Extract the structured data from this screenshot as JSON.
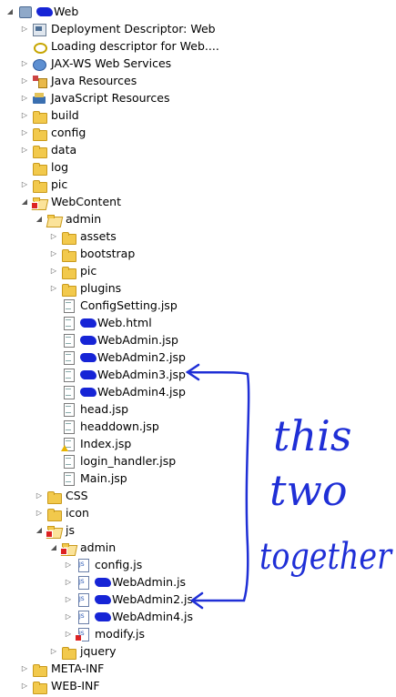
{
  "tree": [
    {
      "label": "Web",
      "level": 0,
      "twisty": "open",
      "icon": "project",
      "scribble": true
    },
    {
      "label": "Deployment Descriptor: Web",
      "level": 1,
      "twisty": "closed",
      "icon": "descriptor"
    },
    {
      "label": "Loading descriptor for Web....",
      "level": 1,
      "twisty": "none",
      "icon": "loading"
    },
    {
      "label": "JAX-WS Web Services",
      "level": 1,
      "twisty": "closed",
      "icon": "jaxws"
    },
    {
      "label": "Java Resources",
      "level": 1,
      "twisty": "closed",
      "icon": "java-resources"
    },
    {
      "label": "JavaScript Resources",
      "level": 1,
      "twisty": "closed",
      "icon": "js-resources"
    },
    {
      "label": "build",
      "level": 1,
      "twisty": "closed",
      "icon": "folder"
    },
    {
      "label": "config",
      "level": 1,
      "twisty": "closed",
      "icon": "folder"
    },
    {
      "label": "data",
      "level": 1,
      "twisty": "closed",
      "icon": "folder"
    },
    {
      "label": "log",
      "level": 1,
      "twisty": "none",
      "icon": "folder"
    },
    {
      "label": "pic",
      "level": 1,
      "twisty": "closed",
      "icon": "folder"
    },
    {
      "label": "WebContent",
      "level": 1,
      "twisty": "open",
      "icon": "folder-open",
      "badge": "error"
    },
    {
      "label": "admin",
      "level": 2,
      "twisty": "open",
      "icon": "folder-open"
    },
    {
      "label": "assets",
      "level": 3,
      "twisty": "closed",
      "icon": "folder"
    },
    {
      "label": "bootstrap",
      "level": 3,
      "twisty": "closed",
      "icon": "folder"
    },
    {
      "label": "pic",
      "level": 3,
      "twisty": "closed",
      "icon": "folder"
    },
    {
      "label": "plugins",
      "level": 3,
      "twisty": "closed",
      "icon": "folder"
    },
    {
      "label": "ConfigSetting.jsp",
      "level": 3,
      "twisty": "none",
      "icon": "file"
    },
    {
      "label": "Web.html",
      "level": 3,
      "twisty": "none",
      "icon": "file",
      "scribble": true
    },
    {
      "label": "WebAdmin.jsp",
      "level": 3,
      "twisty": "none",
      "icon": "file",
      "scribble": true
    },
    {
      "label": "WebAdmin2.jsp",
      "level": 3,
      "twisty": "none",
      "icon": "file",
      "scribble": true
    },
    {
      "label": "WebAdmin3.jsp",
      "level": 3,
      "twisty": "none",
      "icon": "file",
      "scribble": true
    },
    {
      "label": "WebAdmin4.jsp",
      "level": 3,
      "twisty": "none",
      "icon": "file",
      "scribble": true
    },
    {
      "label": "head.jsp",
      "level": 3,
      "twisty": "none",
      "icon": "file"
    },
    {
      "label": "headdown.jsp",
      "level": 3,
      "twisty": "none",
      "icon": "file"
    },
    {
      "label": "Index.jsp",
      "level": 3,
      "twisty": "none",
      "icon": "file",
      "badge": "warning"
    },
    {
      "label": "login_handler.jsp",
      "level": 3,
      "twisty": "none",
      "icon": "file"
    },
    {
      "label": "Main.jsp",
      "level": 3,
      "twisty": "none",
      "icon": "file"
    },
    {
      "label": "CSS",
      "level": 2,
      "twisty": "closed",
      "icon": "folder"
    },
    {
      "label": "icon",
      "level": 2,
      "twisty": "closed",
      "icon": "folder"
    },
    {
      "label": "js",
      "level": 2,
      "twisty": "open",
      "icon": "folder-open",
      "badge": "error"
    },
    {
      "label": "admin",
      "level": 3,
      "twisty": "open",
      "icon": "folder-open",
      "badge": "error"
    },
    {
      "label": "config.js",
      "level": 4,
      "twisty": "closed",
      "icon": "js-file"
    },
    {
      "label": "WebAdmin.js",
      "level": 4,
      "twisty": "closed",
      "icon": "js-file",
      "scribble": true
    },
    {
      "label": "WebAdmin2.js",
      "level": 4,
      "twisty": "closed",
      "icon": "js-file",
      "scribble": true
    },
    {
      "label": "WebAdmin4.js",
      "level": 4,
      "twisty": "closed",
      "icon": "js-file",
      "scribble": true
    },
    {
      "label": "modify.js",
      "level": 4,
      "twisty": "closed",
      "icon": "js-file",
      "badge": "error"
    },
    {
      "label": "jquery",
      "level": 3,
      "twisty": "closed",
      "icon": "folder"
    },
    {
      "label": "META-INF",
      "level": 1,
      "twisty": "closed",
      "icon": "folder"
    },
    {
      "label": "WEB-INF",
      "level": 1,
      "twisty": "closed",
      "icon": "folder"
    }
  ],
  "annotation": {
    "lines": [
      "this",
      "two",
      "together"
    ],
    "color": "#1f2fd6"
  }
}
